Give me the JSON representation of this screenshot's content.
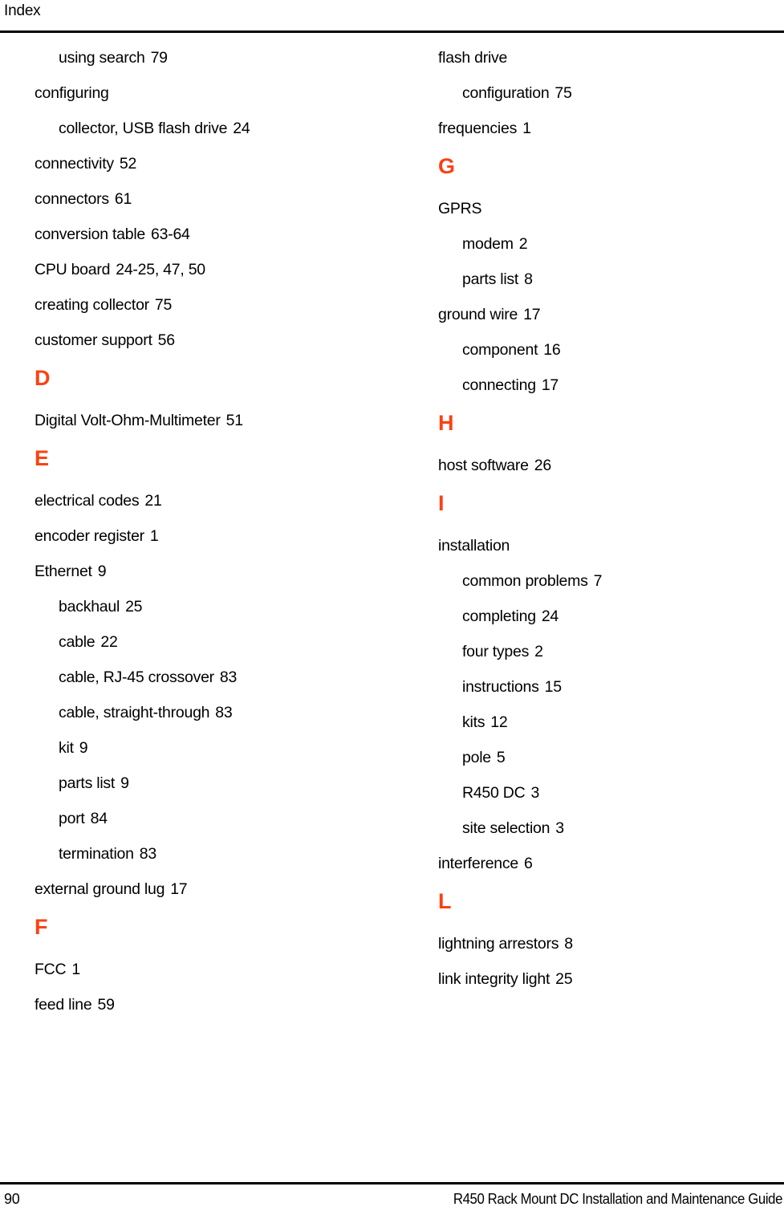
{
  "header": {
    "title": "Index"
  },
  "accent_color": "#fa4213",
  "columns": {
    "left": [
      {
        "kind": "entry",
        "level": 2,
        "text": "using search",
        "locator": "79"
      },
      {
        "kind": "entry",
        "level": 1,
        "text": "configuring",
        "locator": ""
      },
      {
        "kind": "entry",
        "level": 2,
        "text": "collector, USB flash drive",
        "locator": "24"
      },
      {
        "kind": "entry",
        "level": 1,
        "text": "connectivity",
        "locator": "52"
      },
      {
        "kind": "entry",
        "level": 1,
        "text": "connectors",
        "locator": "61"
      },
      {
        "kind": "entry",
        "level": 1,
        "text": "conversion table",
        "locator": "63-64"
      },
      {
        "kind": "entry",
        "level": 1,
        "text": "CPU board",
        "locator": "24-25, 47, 50"
      },
      {
        "kind": "entry",
        "level": 1,
        "text": "creating collector",
        "locator": "75"
      },
      {
        "kind": "entry",
        "level": 1,
        "text": "customer support",
        "locator": "56"
      },
      {
        "kind": "letter",
        "text": "D"
      },
      {
        "kind": "entry",
        "level": 1,
        "text": "Digital Volt-Ohm-Multimeter",
        "locator": "51"
      },
      {
        "kind": "letter",
        "text": "E"
      },
      {
        "kind": "entry",
        "level": 1,
        "text": "electrical codes",
        "locator": "21"
      },
      {
        "kind": "entry",
        "level": 1,
        "text": "encoder register",
        "locator": "1"
      },
      {
        "kind": "entry",
        "level": 1,
        "text": "Ethernet",
        "locator": "9"
      },
      {
        "kind": "entry",
        "level": 2,
        "text": "backhaul",
        "locator": "25"
      },
      {
        "kind": "entry",
        "level": 2,
        "text": "cable",
        "locator": "22"
      },
      {
        "kind": "entry",
        "level": 2,
        "text": "cable, RJ-45 crossover",
        "locator": "83"
      },
      {
        "kind": "entry",
        "level": 2,
        "text": "cable, straight-through",
        "locator": "83"
      },
      {
        "kind": "entry",
        "level": 2,
        "text": "kit",
        "locator": "9"
      },
      {
        "kind": "entry",
        "level": 2,
        "text": "parts list",
        "locator": "9"
      },
      {
        "kind": "entry",
        "level": 2,
        "text": "port",
        "locator": "84"
      },
      {
        "kind": "entry",
        "level": 2,
        "text": "termination",
        "locator": "83"
      },
      {
        "kind": "entry",
        "level": 1,
        "text": "external ground lug",
        "locator": "17"
      },
      {
        "kind": "letter",
        "text": "F"
      },
      {
        "kind": "entry",
        "level": 1,
        "text": "FCC",
        "locator": "1"
      },
      {
        "kind": "entry",
        "level": 1,
        "text": "feed line",
        "locator": "59"
      }
    ],
    "right": [
      {
        "kind": "entry",
        "level": 1,
        "text": "flash drive",
        "locator": ""
      },
      {
        "kind": "entry",
        "level": 2,
        "text": "configuration",
        "locator": "75"
      },
      {
        "kind": "entry",
        "level": 1,
        "text": "frequencies",
        "locator": "1"
      },
      {
        "kind": "letter",
        "text": "G"
      },
      {
        "kind": "entry",
        "level": 1,
        "text": "GPRS",
        "locator": ""
      },
      {
        "kind": "entry",
        "level": 2,
        "text": "modem",
        "locator": "2"
      },
      {
        "kind": "entry",
        "level": 2,
        "text": "parts list",
        "locator": "8"
      },
      {
        "kind": "entry",
        "level": 1,
        "text": "ground wire",
        "locator": "17"
      },
      {
        "kind": "entry",
        "level": 2,
        "text": "component",
        "locator": "16"
      },
      {
        "kind": "entry",
        "level": 2,
        "text": "connecting",
        "locator": "17"
      },
      {
        "kind": "letter",
        "text": "H"
      },
      {
        "kind": "entry",
        "level": 1,
        "text": "host software",
        "locator": "26"
      },
      {
        "kind": "letter",
        "text": "I"
      },
      {
        "kind": "entry",
        "level": 1,
        "text": "installation",
        "locator": ""
      },
      {
        "kind": "entry",
        "level": 2,
        "text": "common problems",
        "locator": "7"
      },
      {
        "kind": "entry",
        "level": 2,
        "text": "completing",
        "locator": "24"
      },
      {
        "kind": "entry",
        "level": 2,
        "text": "four types",
        "locator": "2"
      },
      {
        "kind": "entry",
        "level": 2,
        "text": "instructions",
        "locator": "15"
      },
      {
        "kind": "entry",
        "level": 2,
        "text": "kits",
        "locator": "12"
      },
      {
        "kind": "entry",
        "level": 2,
        "text": "pole",
        "locator": "5"
      },
      {
        "kind": "entry",
        "level": 2,
        "text": "R450 DC",
        "locator": "3"
      },
      {
        "kind": "entry",
        "level": 2,
        "text": "site selection",
        "locator": "3"
      },
      {
        "kind": "entry",
        "level": 1,
        "text": "interference",
        "locator": "6"
      },
      {
        "kind": "letter",
        "text": "L"
      },
      {
        "kind": "entry",
        "level": 1,
        "text": "lightning arrestors",
        "locator": "8"
      },
      {
        "kind": "entry",
        "level": 1,
        "text": "link integrity light",
        "locator": "25"
      }
    ]
  },
  "footer": {
    "page_number": "90",
    "title": "R450 Rack Mount DC Installation and Maintenance Guide"
  }
}
